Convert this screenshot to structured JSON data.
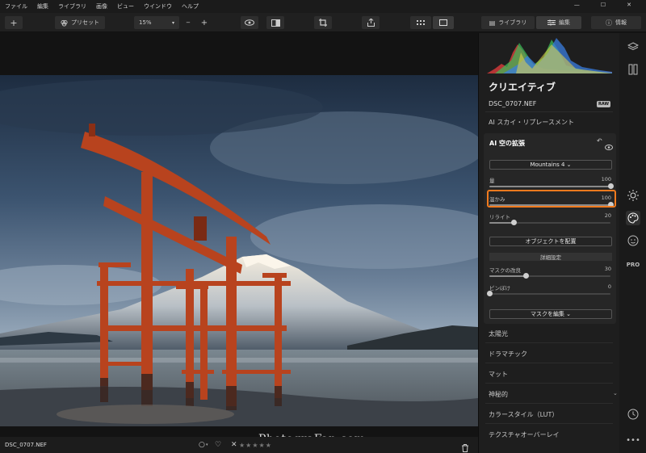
{
  "menu": [
    "ファイル",
    "編集",
    "ライブラリ",
    "画像",
    "ビュー",
    "ウインドウ",
    "ヘルプ"
  ],
  "toolbar": {
    "preset_label": "プリセット",
    "zoom_value": "15%",
    "tab_library": "ライブラリ",
    "tab_edit": "編集",
    "tab_info": "情報"
  },
  "bottom": {
    "filename": "DSC_0707.NEF",
    "stars": "★★★★★"
  },
  "watermark": "PhotograFan.com",
  "panel": {
    "title": "クリエイティブ",
    "filename": "DSC_0707.NEF",
    "raw_badge": "RAW",
    "ai_sky_replacement": "AI スカイ・リプレースメント",
    "sub": {
      "title": "AI 空の拡張",
      "preset_dropdown": "Mountains 4 ⌄",
      "sliders": [
        {
          "label": "量",
          "value": "100",
          "fraction": 1.0
        },
        {
          "label": "温かみ",
          "value": "100",
          "fraction": 1.0
        },
        {
          "label": "リライト",
          "value": "20",
          "fraction": 0.2
        }
      ],
      "place_objects_button": "オブジェクトを配置",
      "advanced_header": "詳細設定",
      "advanced_sliders": [
        {
          "label": "マスクの改良",
          "value": "30",
          "fraction": 0.3
        },
        {
          "label": "ピンぼけ",
          "value": "0",
          "fraction": 0.0
        }
      ],
      "edit_mask_button": "マスクを編集 ⌄"
    },
    "list": [
      "太陽光",
      "ドラマチック",
      "マット",
      "神秘的",
      "カラースタイル（LUT）",
      "テクスチャオーバーレイ"
    ]
  },
  "rail": {
    "pro_label": "PRO"
  },
  "colors": {
    "accent_orange": "#f07a1e",
    "panel_bg": "#1e1e1e"
  }
}
